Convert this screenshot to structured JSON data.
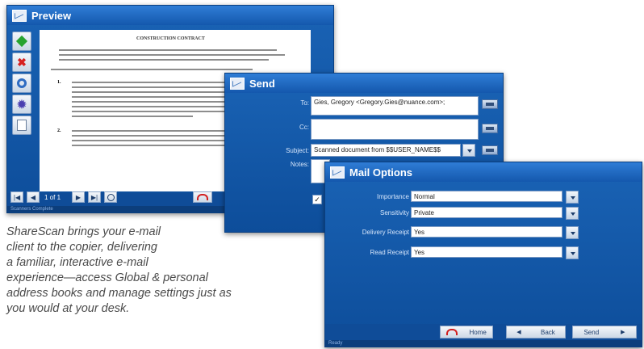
{
  "preview": {
    "title": "Preview",
    "page_indicator": "1 of 1",
    "document_title": "CONSTRUCTION CONTRACT",
    "doc_sections": [
      "1.",
      "2."
    ],
    "status": "Scanners Complete"
  },
  "send": {
    "title": "Send",
    "to_label": "To:",
    "to_value": "Gies, Gregory <Gregory.Gies@nuance.com>;",
    "cc_label": "Cc:",
    "cc_value": "",
    "subject_label": "Subject:",
    "subject_value": "Scanned document from $$USER_NAME$$",
    "notes_label": "Notes:"
  },
  "mail_options": {
    "title": "Mail Options",
    "importance_label": "Importance",
    "importance_value": "Normal",
    "sensitivity_label": "Sensitivity",
    "sensitivity_value": "Private",
    "delivery_receipt_label": "Delivery Receipt",
    "delivery_receipt_value": "Yes",
    "read_receipt_label": "Read Receipt",
    "read_receipt_value": "Yes",
    "home_label": "Home",
    "back_label": "Back",
    "send_label": "Send",
    "status": "Ready"
  },
  "caption_lines": [
    "ShareScan brings your e-mail",
    "client to the copier, delivering",
    "a familiar, interactive e-mail",
    "experience—access Global & personal",
    "address books and manage settings just as",
    "you would at your desk."
  ]
}
